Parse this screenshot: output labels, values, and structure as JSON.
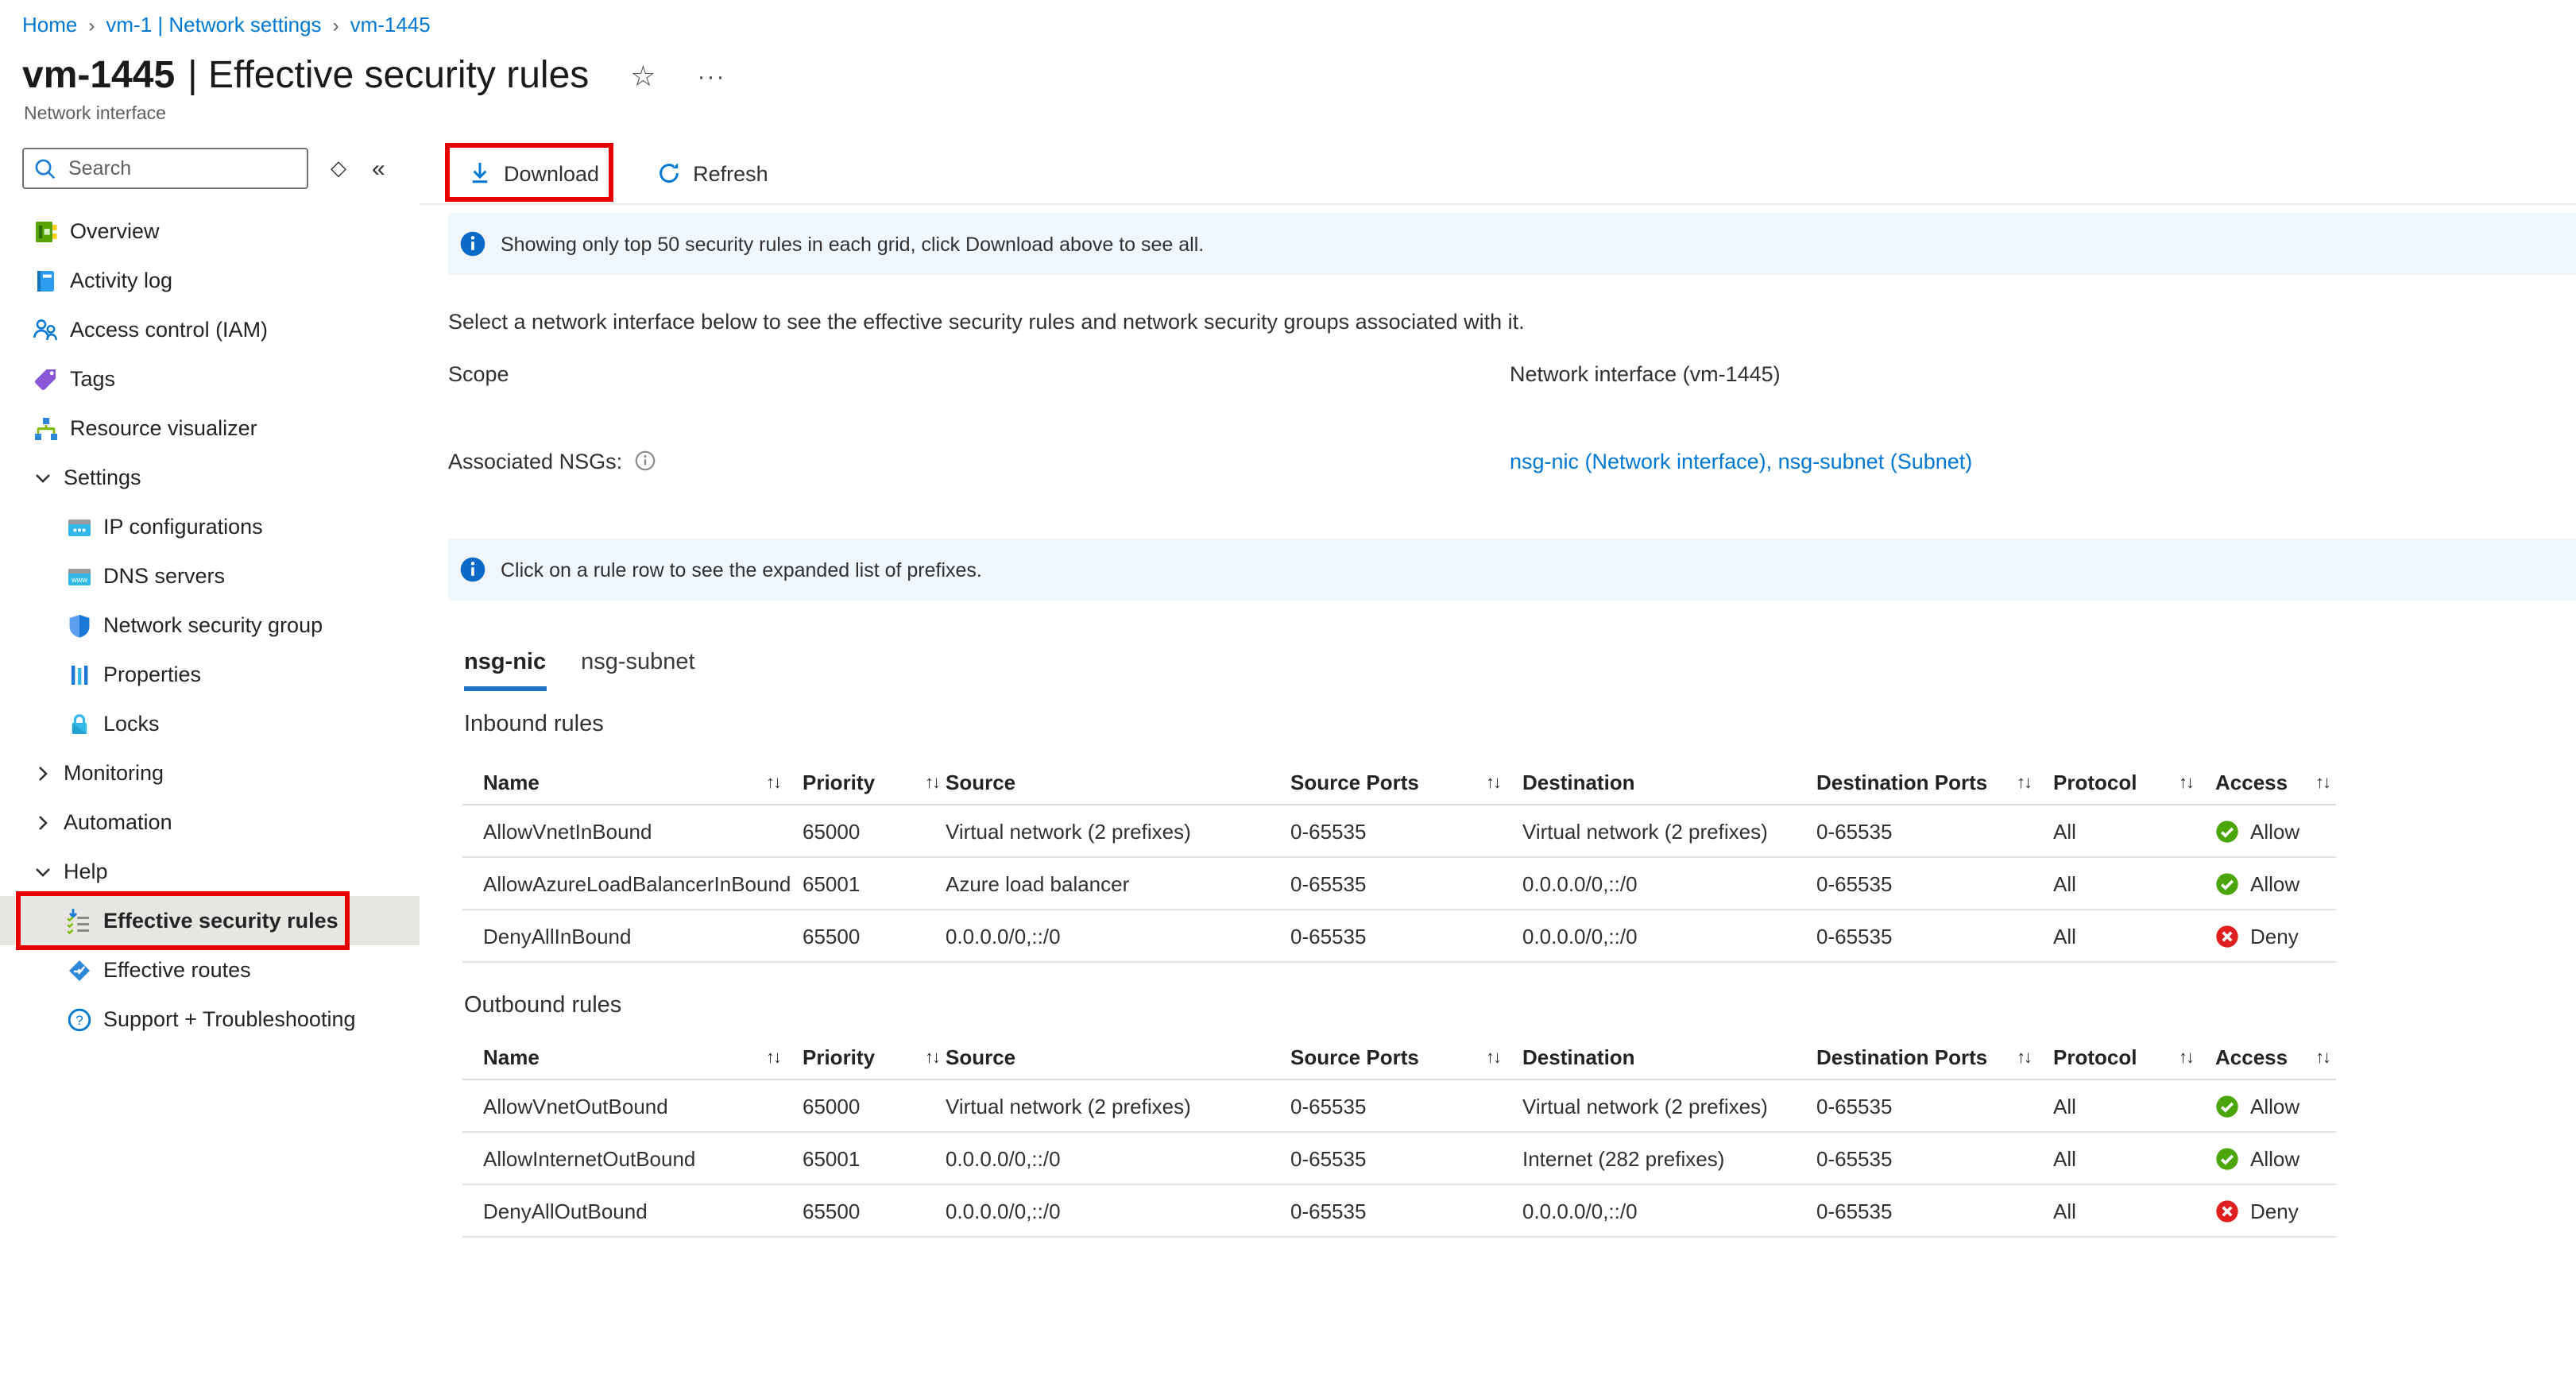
{
  "breadcrumb": [
    "Home",
    "vm-1 | Network settings",
    "vm-1445"
  ],
  "header": {
    "resource_name": "vm-1445",
    "title_page": "| Effective security rules",
    "subtitle": "Network interface"
  },
  "sidebar": {
    "search_placeholder": "Search",
    "items": [
      {
        "label": "Overview",
        "icon": "overview"
      },
      {
        "label": "Activity log",
        "icon": "activity-log"
      },
      {
        "label": "Access control (IAM)",
        "icon": "access-control"
      },
      {
        "label": "Tags",
        "icon": "tags"
      },
      {
        "label": "Resource visualizer",
        "icon": "resource-visualizer"
      },
      {
        "label": "Settings",
        "group": true,
        "expanded": true
      },
      {
        "label": "IP configurations",
        "icon": "ip-configurations",
        "indent": 1
      },
      {
        "label": "DNS servers",
        "icon": "dns-servers",
        "indent": 1
      },
      {
        "label": "Network security group",
        "icon": "network-security-group",
        "indent": 1
      },
      {
        "label": "Properties",
        "icon": "properties",
        "indent": 1
      },
      {
        "label": "Locks",
        "icon": "locks",
        "indent": 1
      },
      {
        "label": "Monitoring",
        "group": true,
        "expanded": false
      },
      {
        "label": "Automation",
        "group": true,
        "expanded": false
      },
      {
        "label": "Help",
        "group": true,
        "expanded": true
      },
      {
        "label": "Effective security rules",
        "icon": "effective-security-rules",
        "indent": 1,
        "selected": true,
        "annotated": true
      },
      {
        "label": "Effective routes",
        "icon": "effective-routes",
        "indent": 1
      },
      {
        "label": "Support + Troubleshooting",
        "icon": "support",
        "indent": 1
      }
    ]
  },
  "toolbar": {
    "download_label": "Download",
    "refresh_label": "Refresh"
  },
  "banners": {
    "top_info": "Showing only top 50 security rules in each grid, click Download above to see all.",
    "prefix_info": "Click on a rule row to see the expanded list of prefixes."
  },
  "content": {
    "intro": "Select a network interface below to see the effective security rules and network security groups associated with it.",
    "scope_label": "Scope",
    "scope_value": "Network interface (vm-1445)",
    "nsg_label": "Associated NSGs:",
    "nsg_value": "nsg-nic (Network interface), nsg-subnet (Subnet)"
  },
  "tabs": [
    {
      "label": "nsg-nic",
      "selected": true
    },
    {
      "label": "nsg-subnet",
      "selected": false
    }
  ],
  "tables": {
    "columns": [
      {
        "label": "Name",
        "sortable": true
      },
      {
        "label": "Priority",
        "sortable": true
      },
      {
        "label": "Source",
        "sortable": false
      },
      {
        "label": "Source Ports",
        "sortable": true
      },
      {
        "label": "Destination",
        "sortable": false
      },
      {
        "label": "Destination Ports",
        "sortable": true
      },
      {
        "label": "Protocol",
        "sortable": true
      },
      {
        "label": "Access",
        "sortable": true
      }
    ],
    "inbound": {
      "title": "Inbound rules",
      "rows": [
        {
          "name": "AllowVnetInBound",
          "priority": "65000",
          "source": "Virtual network (2 prefixes)",
          "source_ports": "0-65535",
          "destination": "Virtual network (2 prefixes)",
          "destination_ports": "0-65535",
          "protocol": "All",
          "access": "Allow"
        },
        {
          "name": "AllowAzureLoadBalancerInBound",
          "priority": "65001",
          "source": "Azure load balancer",
          "source_ports": "0-65535",
          "destination": "0.0.0.0/0,::/0",
          "destination_ports": "0-65535",
          "protocol": "All",
          "access": "Allow"
        },
        {
          "name": "DenyAllInBound",
          "priority": "65500",
          "source": "0.0.0.0/0,::/0",
          "source_ports": "0-65535",
          "destination": "0.0.0.0/0,::/0",
          "destination_ports": "0-65535",
          "protocol": "All",
          "access": "Deny"
        }
      ]
    },
    "outbound": {
      "title": "Outbound rules",
      "rows": [
        {
          "name": "AllowVnetOutBound",
          "priority": "65000",
          "source": "Virtual network (2 prefixes)",
          "source_ports": "0-65535",
          "destination": "Virtual network (2 prefixes)",
          "destination_ports": "0-65535",
          "protocol": "All",
          "access": "Allow"
        },
        {
          "name": "AllowInternetOutBound",
          "priority": "65001",
          "source": "0.0.0.0/0,::/0",
          "source_ports": "0-65535",
          "destination": "Internet (282 prefixes)",
          "destination_ports": "0-65535",
          "protocol": "All",
          "access": "Allow"
        },
        {
          "name": "DenyAllOutBound",
          "priority": "65500",
          "source": "0.0.0.0/0,::/0",
          "source_ports": "0-65535",
          "destination": "0.0.0.0/0,::/0",
          "destination_ports": "0-65535",
          "protocol": "All",
          "access": "Deny"
        }
      ]
    }
  },
  "colors": {
    "accent": "#0078d4",
    "allow_green": "#4ca50a",
    "deny_red": "#e02020",
    "annotation_red": "#e60000",
    "banner_bg": "#eff6fc",
    "selected_bg": "#e8e6e3"
  }
}
